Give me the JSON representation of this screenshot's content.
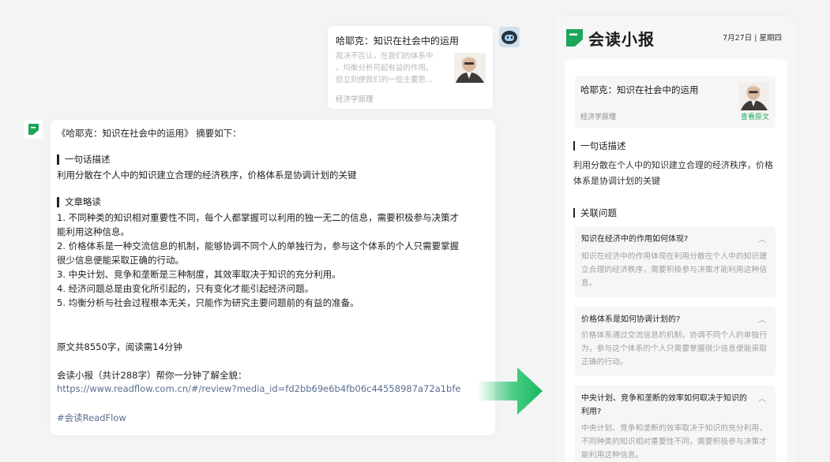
{
  "colors": {
    "brand_green": "#1da55a",
    "link_blue": "#5a6f8d",
    "background": "#f3f4f3"
  },
  "icons": {
    "user_avatar": "robot-avatar-icon",
    "bot_avatar": "readflow-logo-icon",
    "collapse": "chevron-up-icon",
    "arrow": "arrow-right-icon"
  },
  "share_card": {
    "title": "哈耶克：知识在社会中的运用",
    "excerpt": [
      "我决不否认，在我们的体系中",
      "，均衡分析可起有益的作用。",
      "但立刻使我们的一些主要思..."
    ],
    "source": "经济学原理"
  },
  "message": {
    "intro": "《哈耶克：知识在社会中的运用》 摘要如下：",
    "one_line_heading": "一句话描述",
    "one_line_text": "利用分散在个人中的知识建立合理的经济秩序，价格体系是协调计划的关键",
    "outline_heading": "文章略读",
    "outline_lines": [
      "1. 不同种类的知识相对重要性不同，每个人都掌握可以利用的独一无二的信息，需要积极参与决策才",
      "能利用这种信息。",
      "2. 价格体系是一种交流信息的机制，能够协调不同个人的单独行为，参与这个体系的个人只需要掌握",
      "很少信息便能采取正确的行动。",
      "3. 中央计划、竞争和垄断是三种制度，其效率取决于知识的充分利用。",
      "4. 经济问题总是由变化所引起的，只有变化才能引起经济问题。",
      "5. 均衡分析与社会过程根本无关，只能作为研究主要问题前的有益的准备。"
    ],
    "stats": "原文共8550字，阅读需14分钟",
    "cta": "会读小报（共计288字）帮你一分钟了解全貌：",
    "link": "https://www.readflow.com.cn/#/review?media_id=fd2bb69e6b4fb06c44558987a72a1bfe",
    "hashtag": "#会读ReadFlow"
  },
  "panel": {
    "brand": "会读小报",
    "date": "7月27日 | 星期四",
    "article": {
      "title": "哈耶克：知识在社会中的运用",
      "source": "经济学原理",
      "view_original": "查看原文"
    },
    "one_line_heading": "一句话描述",
    "summary": "利用分散在个人中的知识建立合理的经济秩序，价格体系是协调计划的关键",
    "related_heading": "关联问题",
    "questions": [
      {
        "q": "知识在经济中的作用如何体现?",
        "a": "知识在经济中的作用体现在利用分散在个人中的知识建立合理的经济秩序，需要积极参与决策才能利用这种信息。"
      },
      {
        "q": "价格体系是如何协调计划的?",
        "a": "价格体系通过交流信息的机制，协调不同个人的单独行为，参与这个体系的个人只需要掌握很少信息便能采取正确的行动。"
      },
      {
        "q": "中央计划、竞争和垄断的效率如何取决于知识的利用?",
        "a": "中央计划、竞争和垄断的效率取决于知识的充分利用，不同种类的知识相对重要性不同，需要积极参与决策才能利用这种信息。"
      }
    ]
  }
}
